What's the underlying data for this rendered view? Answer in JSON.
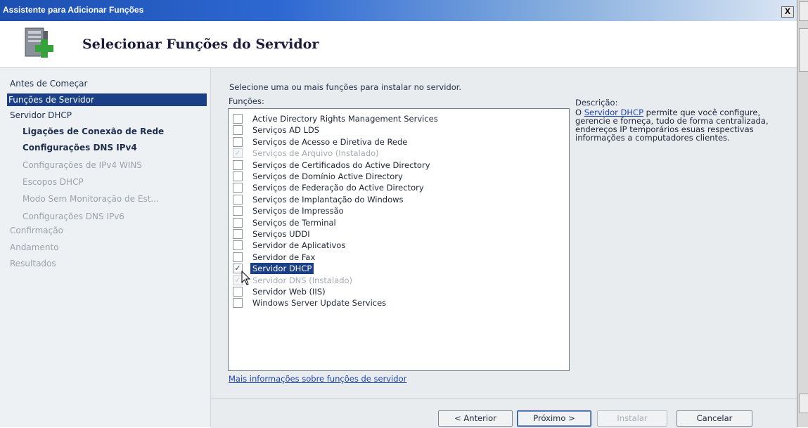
{
  "window": {
    "title": "Assistente para Adicionar Funções",
    "close_label": "X"
  },
  "header": {
    "icon_name": "server-add-icon",
    "title": "Selecionar Funções do Servidor"
  },
  "nav": {
    "items": [
      {
        "label": "Antes de Começar",
        "state": "normal"
      },
      {
        "label": "Funções de Servidor",
        "state": "selected"
      },
      {
        "label": "Servidor DHCP",
        "state": "normal"
      },
      {
        "label": "Ligações de Conexão de Rede",
        "state": "bold"
      },
      {
        "label": "Configurações DNS IPv4",
        "state": "bold"
      },
      {
        "label": "Configurações de IPv4 WINS",
        "state": "disabled"
      },
      {
        "label": "Escopos DHCP",
        "state": "disabled"
      },
      {
        "label": "Modo Sem Monitoração de Est...",
        "state": "disabled"
      },
      {
        "label": "Configurações DNS IPv6",
        "state": "disabled"
      },
      {
        "label": "Confirmação",
        "state": "disabled"
      },
      {
        "label": "Andamento",
        "state": "disabled"
      },
      {
        "label": "Resultados",
        "state": "disabled"
      }
    ]
  },
  "main": {
    "instruction": "Selecione uma ou mais funções para instalar no servidor.",
    "functions_label": "Funções:",
    "roles": [
      {
        "label": "Active Directory Rights Management Services",
        "checked": false,
        "disabled": false,
        "selected": false
      },
      {
        "label": "Serviços AD LDS",
        "checked": false,
        "disabled": false,
        "selected": false
      },
      {
        "label": "Serviços de Acesso e Diretiva de Rede",
        "checked": false,
        "disabled": false,
        "selected": false
      },
      {
        "label": "Serviços de Arquivo  (Instalado)",
        "checked": true,
        "disabled": true,
        "selected": false
      },
      {
        "label": "Serviços de Certificados do Active Directory",
        "checked": false,
        "disabled": false,
        "selected": false
      },
      {
        "label": "Serviços de Domínio Active Directory",
        "checked": false,
        "disabled": false,
        "selected": false
      },
      {
        "label": "Serviços de Federação do Active Directory",
        "checked": false,
        "disabled": false,
        "selected": false
      },
      {
        "label": "Serviços de Implantação do Windows",
        "checked": false,
        "disabled": false,
        "selected": false
      },
      {
        "label": "Serviços de Impressão",
        "checked": false,
        "disabled": false,
        "selected": false
      },
      {
        "label": "Serviços de Terminal",
        "checked": false,
        "disabled": false,
        "selected": false
      },
      {
        "label": "Serviços UDDI",
        "checked": false,
        "disabled": false,
        "selected": false
      },
      {
        "label": "Servidor de Aplicativos",
        "checked": false,
        "disabled": false,
        "selected": false
      },
      {
        "label": "Servidor de Fax",
        "checked": false,
        "disabled": false,
        "selected": false
      },
      {
        "label": "Servidor DHCP",
        "checked": true,
        "disabled": false,
        "selected": true
      },
      {
        "label": "Servidor DNS  (Instalado)",
        "checked": true,
        "disabled": true,
        "selected": false
      },
      {
        "label": "Servidor Web (IIS)",
        "checked": false,
        "disabled": false,
        "selected": false
      },
      {
        "label": "Windows Server Update Services",
        "checked": false,
        "disabled": false,
        "selected": false
      }
    ],
    "description": {
      "title": "Descrição:",
      "prefix": "O ",
      "link": "Servidor DHCP",
      "text": " permite que você configure, gerencie e forneça, tudo de forma centralizada, endereços IP temporários esuas respectivas informações a computadores clientes."
    },
    "more_info_link": "Mais informações sobre funções de servidor"
  },
  "footer": {
    "back_label": "< Anterior",
    "next_label": "Próximo >",
    "install_label": "Instalar",
    "cancel_label": "Cancelar"
  },
  "colors": {
    "title_bar": "#2d68d2",
    "selection": "#1a3f86",
    "link": "#1d44b3",
    "panel": "#e9ecef"
  }
}
